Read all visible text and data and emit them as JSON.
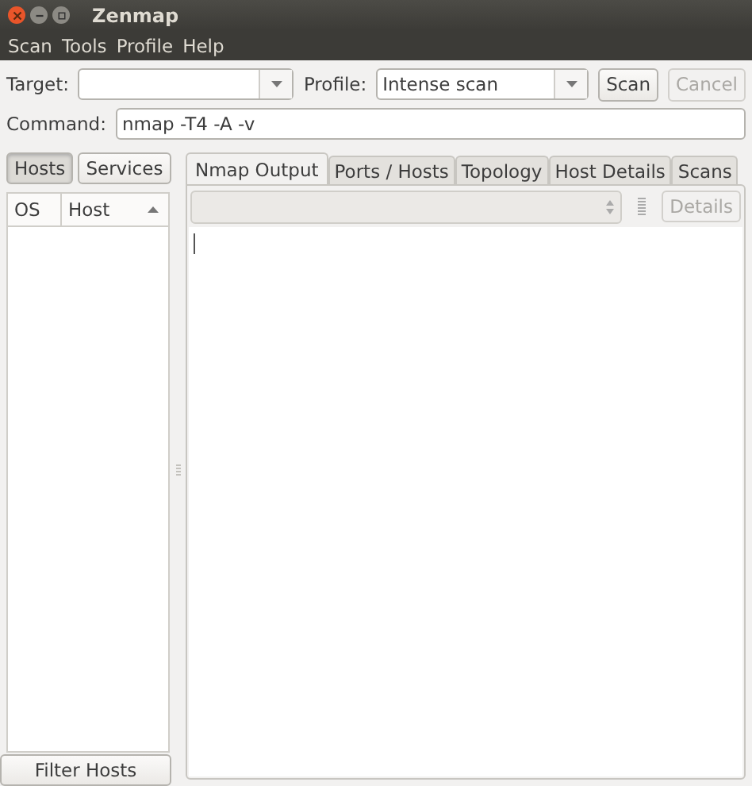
{
  "window": {
    "title": "Zenmap"
  },
  "menu": [
    "Scan",
    "Tools",
    "Profile",
    "Help"
  ],
  "toolbar": {
    "target_label": "Target:",
    "profile_label": "Profile:",
    "profile_value": "Intense scan",
    "buttons": [
      {
        "label": "Scan",
        "disabled": false
      },
      {
        "label": "Cancel",
        "disabled": true
      }
    ]
  },
  "command": {
    "label": "Command:",
    "value": "nmap -T4 -A -v"
  },
  "view_tabs": [
    {
      "label": "Hosts",
      "selected": true
    },
    {
      "label": "Services",
      "selected": false
    }
  ],
  "host_columns": [
    {
      "label": "OS",
      "sorted": false
    },
    {
      "label": "Host",
      "sorted": true
    }
  ],
  "filter_button": "Filter Hosts",
  "output_tabs": [
    {
      "label": "Nmap Output",
      "selected": true
    },
    {
      "label": "Ports / Hosts",
      "selected": false
    },
    {
      "label": "Topology",
      "selected": false
    },
    {
      "label": "Host Details",
      "selected": false
    },
    {
      "label": "Scans",
      "selected": false
    }
  ],
  "details_button": {
    "label": "Details",
    "disabled": true
  }
}
